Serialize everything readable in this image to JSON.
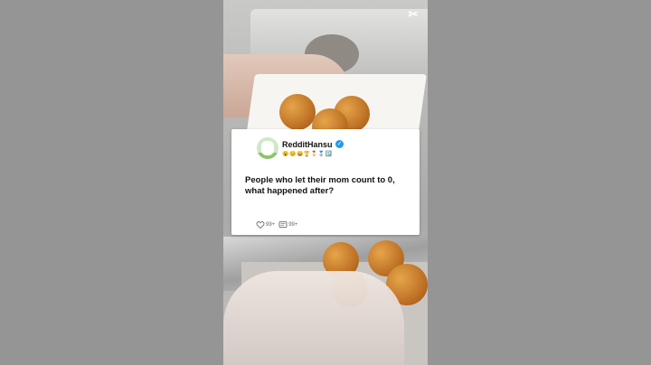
{
  "post": {
    "username": "RedditHansu",
    "badges": "😮😊😄🏆🎖️🥈🅿️",
    "title": "People who let their mom count to 0, what happened after?",
    "likes": "99+",
    "comments": "99+"
  },
  "overlay": {
    "brand_mark": "✂"
  },
  "colors": {
    "verified": "#1d9bf0",
    "side_bars": "#959595"
  }
}
